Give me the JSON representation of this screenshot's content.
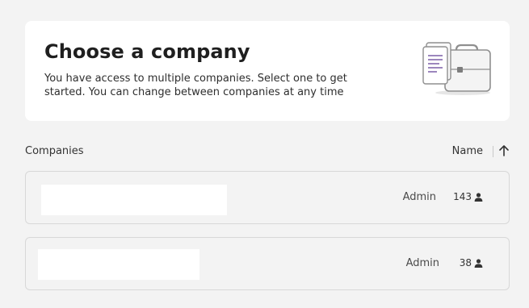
{
  "intro": {
    "title": "Choose a company",
    "subtitle": "You have access to multiple companies. Select one to get started. You can change between companies at any time"
  },
  "list": {
    "header_label": "Companies",
    "sort_label": "Name",
    "sort_direction": "ascending"
  },
  "companies": [
    {
      "role": "Admin",
      "member_count": "143"
    },
    {
      "role": "Admin",
      "member_count": "38"
    }
  ],
  "icons": {
    "illustration": "documents-briefcase-illustration",
    "sort": "arrow-up-icon",
    "members": "person-icon"
  },
  "colors": {
    "background": "#f3f3f3",
    "card": "#ffffff",
    "accent_purple": "#7b5ea7"
  }
}
